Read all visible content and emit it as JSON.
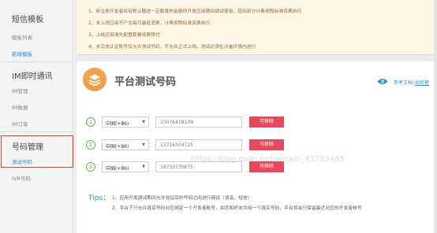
{
  "sidebar": {
    "sections": [
      {
        "title": "短信模板",
        "items": [
          {
            "label": "模板列表",
            "active": false
          },
          {
            "label": "新增模板",
            "active": true
          }
        ]
      },
      {
        "title": "IM即时通讯",
        "items": [
          {
            "label": "IM管理",
            "active": false
          },
          {
            "label": "IM数据",
            "active": false
          },
          {
            "label": "IM订单",
            "active": false
          }
        ]
      },
      {
        "title": "号码管理",
        "items": [
          {
            "label": "测试号码",
            "active": true
          },
          {
            "label": "IVR号码",
            "active": false
          }
        ]
      }
    ]
  },
  "notice": {
    "lines": [
      "1、新注册开发者将有默认赠送一定额度的金额供开发应用期间调试使用，超出部分计费按照标准资费执行",
      "2、未上线应用不产生每月最低消费，计费按照标准资费执行",
      "3、上线应用请先配置套餐续费预付",
      "4、未完成认证账号仅允许测试号码，不允许正式上线。测试必须在沙盒环境内进行"
    ]
  },
  "panel": {
    "title": "平台测试号码",
    "ref_label": "参考文档：",
    "ref_link": "如何使"
  },
  "test_numbers": [
    {
      "index": "1",
      "country": "中国(+86)",
      "phone": "15076418109",
      "remove_label": "可移除"
    },
    {
      "index": "2",
      "country": "中国(+86)",
      "phone": "13716504725",
      "remove_label": "可移除"
    },
    {
      "index": "3",
      "country": "中国(+86)",
      "phone": "18733170675",
      "remove_label": "可移除"
    }
  ],
  "tips": {
    "label": "Tips：",
    "lines": [
      "1、应用开发调试期间允许验证后的号码之间进行调试（语音、短信）",
      "2、平台下只允许真实号码对应绑定一个开发者帐号，如您和好友共用一个真实号码，平台将会只保留最近对应的开发者帐号"
    ]
  },
  "watermark": "https://blog.csdn.net/weixin_43783485",
  "colors": {
    "accent": "#2a8fd6",
    "remove": "#e9475a",
    "highlight": "#e23b3b",
    "index_green": "#6ab04c",
    "title_icon": "#f0a046"
  }
}
